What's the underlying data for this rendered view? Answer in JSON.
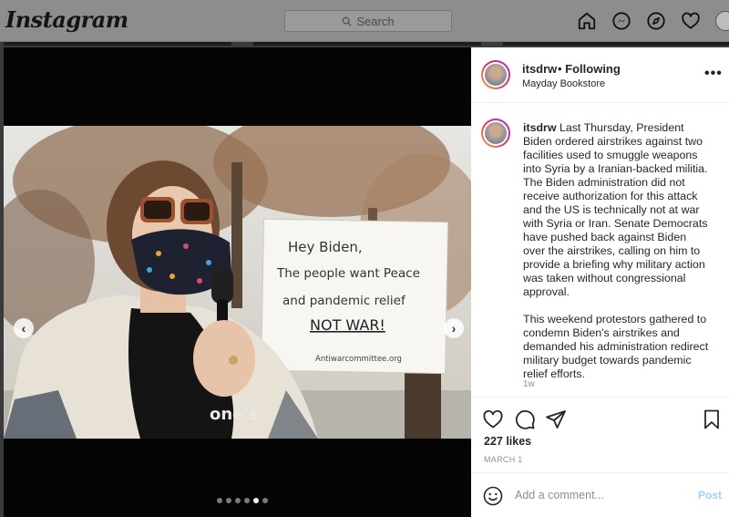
{
  "nav": {
    "logo": "Instagram",
    "search_placeholder": "Search",
    "icons": [
      "home-icon",
      "messenger-icon",
      "explore-icon",
      "heart-icon",
      "profile-avatar"
    ]
  },
  "post": {
    "username": "itsdrw",
    "following": "• Following",
    "location": "Mayday Bookstore",
    "more": "•••",
    "sign": {
      "line1": "Hey Biden,",
      "line2": "The people want Peace",
      "line3": "and pandemic relief",
      "line4": "NOT WAR!",
      "line5": "Antiwarcommittee.org"
    },
    "carousel": {
      "total": 6,
      "active": 5
    },
    "caption": {
      "username": "itsdrw",
      "paragraph1": "Last Thursday, President Biden ordered airstrikes against two facilities used to smuggle weapons into Syria by a Iranian-backed militia. The Biden administration did not receive authorization for this attack and the US is technically not at war with Syria or Iran. Senate Democrats have pushed back against Biden over the airstrikes, calling on him to provide a briefing why military action was taken without congressional approval.",
      "paragraph2": "This weekend protestors gathered to condemn Biden's airstrikes and demanded his administration redirect military budget towards pandemic relief efforts."
    },
    "age": "1w",
    "likes": "227 likes",
    "date": "MARCH 1",
    "comment_placeholder": "Add a comment...",
    "post_label": "Post"
  },
  "colors": {
    "accent_post": "#9fd0f5",
    "overlay": "#3a3a3a",
    "secondary_text": "#8e8e8e"
  }
}
